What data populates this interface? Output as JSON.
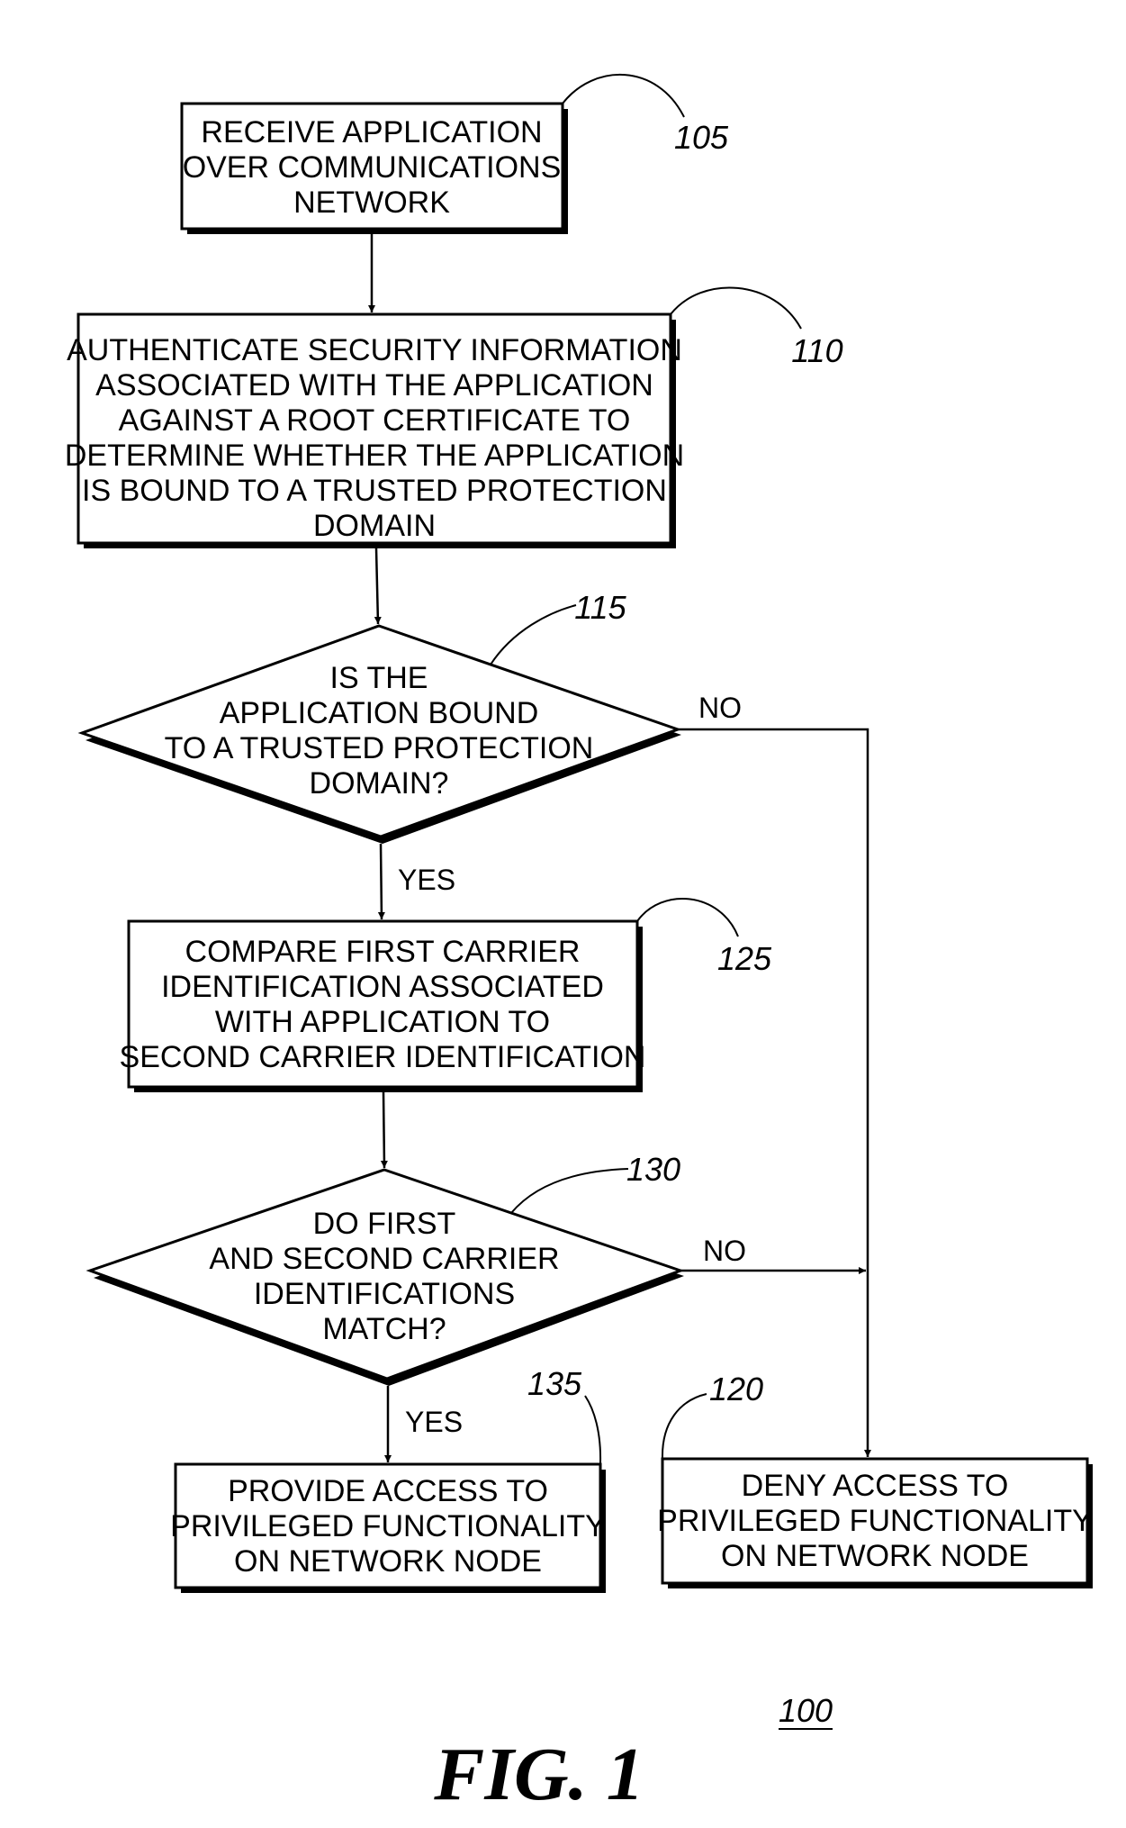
{
  "figure": {
    "caption": "FIG. 1",
    "reference": "100"
  },
  "steps": {
    "s105": {
      "ref": "105",
      "type": "process",
      "lines": [
        "RECEIVE APPLICATION",
        "OVER COMMUNICATIONS",
        "NETWORK"
      ]
    },
    "s110": {
      "ref": "110",
      "type": "process",
      "lines": [
        "AUTHENTICATE SECURITY INFORMATION",
        "ASSOCIATED WITH THE APPLICATION",
        "AGAINST A ROOT CERTIFICATE TO",
        "DETERMINE WHETHER THE APPLICATION",
        "IS BOUND TO A TRUSTED PROTECTION",
        "DOMAIN"
      ]
    },
    "s115": {
      "ref": "115",
      "type": "decision",
      "lines": [
        "IS THE",
        "APPLICATION BOUND",
        "TO A TRUSTED PROTECTION",
        "DOMAIN?"
      ],
      "yes": "YES",
      "no": "NO"
    },
    "s125": {
      "ref": "125",
      "type": "process",
      "lines": [
        "COMPARE FIRST CARRIER",
        "IDENTIFICATION ASSOCIATED",
        "WITH APPLICATION TO",
        "SECOND CARRIER IDENTIFICATION"
      ]
    },
    "s130": {
      "ref": "130",
      "type": "decision",
      "lines": [
        "DO FIRST",
        "AND SECOND CARRIER",
        "IDENTIFICATIONS",
        "MATCH?"
      ],
      "yes": "YES",
      "no": "NO"
    },
    "s135": {
      "ref": "135",
      "type": "process",
      "lines": [
        "PROVIDE ACCESS TO",
        "PRIVILEGED FUNCTIONALITY",
        "ON NETWORK NODE"
      ]
    },
    "s120": {
      "ref": "120",
      "type": "process",
      "lines": [
        "DENY ACCESS TO",
        "PRIVILEGED FUNCTIONALITY",
        "ON NETWORK NODE"
      ]
    }
  },
  "edges": [
    {
      "from": "105",
      "to": "110",
      "label": ""
    },
    {
      "from": "110",
      "to": "115",
      "label": ""
    },
    {
      "from": "115",
      "to": "125",
      "label": "YES"
    },
    {
      "from": "115",
      "to": "120",
      "label": "NO"
    },
    {
      "from": "125",
      "to": "130",
      "label": ""
    },
    {
      "from": "130",
      "to": "135",
      "label": "YES"
    },
    {
      "from": "130",
      "to": "120",
      "label": "NO"
    }
  ]
}
